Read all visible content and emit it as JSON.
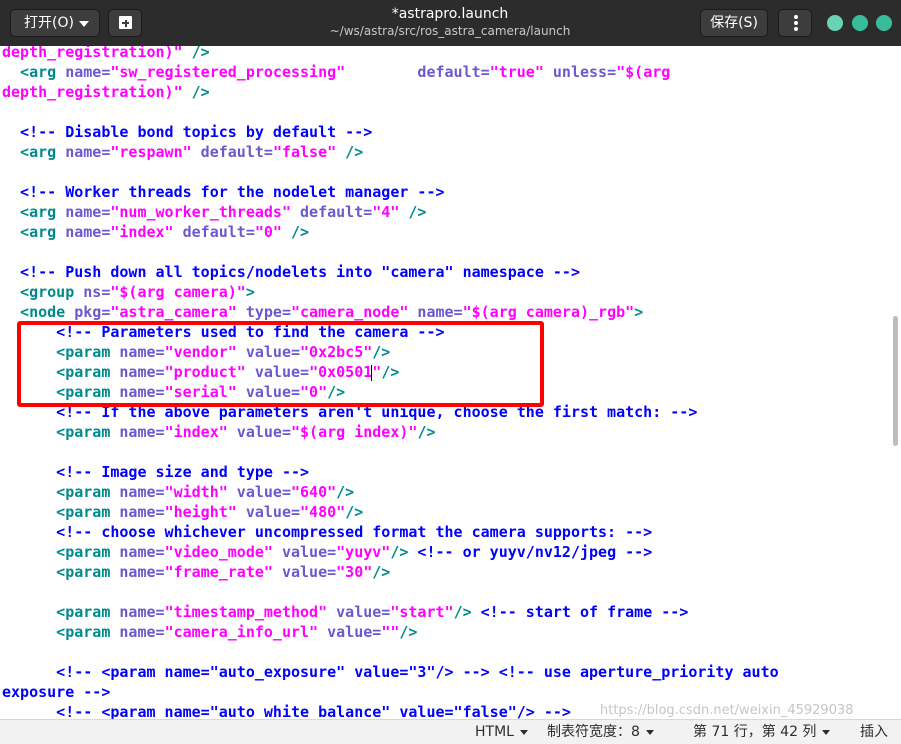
{
  "titlebar": {
    "open_label": "打开(O)",
    "save_label": "保存(S)",
    "file_name": "*astrapro.launch",
    "file_path": "~/ws/astra/src/ros_astra_camera/launch"
  },
  "editor": {
    "lines": [
      [
        [
          "depth_registration)\"",
          "c-str"
        ],
        [
          " />",
          "c-tag"
        ]
      ],
      [
        [
          "  <arg",
          "c-tag"
        ],
        [
          " name=",
          "c-attr"
        ],
        [
          "\"sw_registered_processing\"",
          "c-str"
        ],
        [
          "        default=",
          "c-attr"
        ],
        [
          "\"true\"",
          "c-str"
        ],
        [
          " unless=",
          "c-attr"
        ],
        [
          "\"$(arg",
          "c-str"
        ]
      ],
      [
        [
          "depth_registration)\"",
          "c-str"
        ],
        [
          " />",
          "c-tag"
        ]
      ],
      [],
      [
        [
          "  <!-- Disable bond topics by default -->",
          "c-com"
        ]
      ],
      [
        [
          "  <arg",
          "c-tag"
        ],
        [
          " name=",
          "c-attr"
        ],
        [
          "\"respawn\"",
          "c-str"
        ],
        [
          " default=",
          "c-attr"
        ],
        [
          "\"false\"",
          "c-str"
        ],
        [
          " />",
          "c-tag"
        ]
      ],
      [],
      [
        [
          "  <!-- Worker threads for the nodelet manager -->",
          "c-com"
        ]
      ],
      [
        [
          "  <arg",
          "c-tag"
        ],
        [
          " name=",
          "c-attr"
        ],
        [
          "\"num_worker_threads\"",
          "c-str"
        ],
        [
          " default=",
          "c-attr"
        ],
        [
          "\"4\"",
          "c-str"
        ],
        [
          " />",
          "c-tag"
        ]
      ],
      [
        [
          "  <arg",
          "c-tag"
        ],
        [
          " name=",
          "c-attr"
        ],
        [
          "\"index\"",
          "c-str"
        ],
        [
          " default=",
          "c-attr"
        ],
        [
          "\"0\"",
          "c-str"
        ],
        [
          " />",
          "c-tag"
        ]
      ],
      [],
      [
        [
          "  <!-- Push down all topics/nodelets into \"camera\" namespace -->",
          "c-com"
        ]
      ],
      [
        [
          "  <group",
          "c-tag"
        ],
        [
          " ns=",
          "c-attr"
        ],
        [
          "\"$(arg camera)\"",
          "c-str"
        ],
        [
          ">",
          "c-tag"
        ]
      ],
      [
        [
          "  <node",
          "c-tag"
        ],
        [
          " pkg=",
          "c-attr"
        ],
        [
          "\"astra_camera\"",
          "c-str"
        ],
        [
          " type=",
          "c-attr"
        ],
        [
          "\"camera_node\"",
          "c-str"
        ],
        [
          " name=",
          "c-attr"
        ],
        [
          "\"$(arg camera)_rgb\"",
          "c-str"
        ],
        [
          ">",
          "c-tag"
        ]
      ],
      [
        [
          "      <!-- Parameters used to find the camera -->",
          "c-com"
        ]
      ],
      [
        [
          "      <param",
          "c-tag"
        ],
        [
          " name=",
          "c-attr"
        ],
        [
          "\"vendor\"",
          "c-str"
        ],
        [
          " value=",
          "c-attr"
        ],
        [
          "\"0x2bc5\"",
          "c-str"
        ],
        [
          "/>",
          "c-tag"
        ]
      ],
      [
        [
          "      <param",
          "c-tag"
        ],
        [
          " name=",
          "c-attr"
        ],
        [
          "\"product\"",
          "c-str"
        ],
        [
          " value=",
          "c-attr"
        ],
        [
          "\"0x0501",
          "c-str"
        ],
        [
          "|",
          "cursor"
        ],
        [
          "\"",
          "c-str"
        ],
        [
          "/>",
          "c-tag"
        ]
      ],
      [
        [
          "      <param",
          "c-tag"
        ],
        [
          " name=",
          "c-attr"
        ],
        [
          "\"serial\"",
          "c-str"
        ],
        [
          " value=",
          "c-attr"
        ],
        [
          "\"0\"",
          "c-str"
        ],
        [
          "/>",
          "c-tag"
        ]
      ],
      [
        [
          "      <!-- If the above parameters aren't unique, choose the first match: -->",
          "c-com"
        ]
      ],
      [
        [
          "      <param",
          "c-tag"
        ],
        [
          " name=",
          "c-attr"
        ],
        [
          "\"index\"",
          "c-str"
        ],
        [
          " value=",
          "c-attr"
        ],
        [
          "\"$(arg index)\"",
          "c-str"
        ],
        [
          "/>",
          "c-tag"
        ]
      ],
      [],
      [
        [
          "      <!-- Image size and type -->",
          "c-com"
        ]
      ],
      [
        [
          "      <param",
          "c-tag"
        ],
        [
          " name=",
          "c-attr"
        ],
        [
          "\"width\"",
          "c-str"
        ],
        [
          " value=",
          "c-attr"
        ],
        [
          "\"640\"",
          "c-str"
        ],
        [
          "/>",
          "c-tag"
        ]
      ],
      [
        [
          "      <param",
          "c-tag"
        ],
        [
          " name=",
          "c-attr"
        ],
        [
          "\"height\"",
          "c-str"
        ],
        [
          " value=",
          "c-attr"
        ],
        [
          "\"480\"",
          "c-str"
        ],
        [
          "/>",
          "c-tag"
        ]
      ],
      [
        [
          "      <!-- choose whichever uncompressed format the camera supports: -->",
          "c-com"
        ]
      ],
      [
        [
          "      <param",
          "c-tag"
        ],
        [
          " name=",
          "c-attr"
        ],
        [
          "\"video_mode\"",
          "c-str"
        ],
        [
          " value=",
          "c-attr"
        ],
        [
          "\"yuyv\"",
          "c-str"
        ],
        [
          "/>",
          "c-tag"
        ],
        [
          " <!-- or yuyv/nv12/jpeg -->",
          "c-com"
        ]
      ],
      [
        [
          "      <param",
          "c-tag"
        ],
        [
          " name=",
          "c-attr"
        ],
        [
          "\"frame_rate\"",
          "c-str"
        ],
        [
          " value=",
          "c-attr"
        ],
        [
          "\"30\"",
          "c-str"
        ],
        [
          "/>",
          "c-tag"
        ]
      ],
      [],
      [
        [
          "      <param",
          "c-tag"
        ],
        [
          " name=",
          "c-attr"
        ],
        [
          "\"timestamp_method\"",
          "c-str"
        ],
        [
          " value=",
          "c-attr"
        ],
        [
          "\"start\"",
          "c-str"
        ],
        [
          "/>",
          "c-tag"
        ],
        [
          " <!-- start of frame -->",
          "c-com"
        ]
      ],
      [
        [
          "      <param",
          "c-tag"
        ],
        [
          " name=",
          "c-attr"
        ],
        [
          "\"camera_info_url\"",
          "c-str"
        ],
        [
          " value=",
          "c-attr"
        ],
        [
          "\"\"",
          "c-str"
        ],
        [
          "/>",
          "c-tag"
        ]
      ],
      [],
      [
        [
          "      <!-- <param name=\"auto_exposure\" value=\"3\"/> --> <!-- use aperture_priority auto",
          "c-com"
        ]
      ],
      [
        [
          "exposure -->",
          "c-com"
        ]
      ],
      [
        [
          "      <!-- <param name=\"auto_white_balance\" value=\"false\"/> -->",
          "c-com"
        ]
      ]
    ]
  },
  "statusbar": {
    "language": "HTML",
    "tab_width": "制表符宽度：8",
    "position": "第 71 行，第 42 列",
    "mode": "插入"
  },
  "watermark": "https://blog.csdn.net/weixin_45929038"
}
